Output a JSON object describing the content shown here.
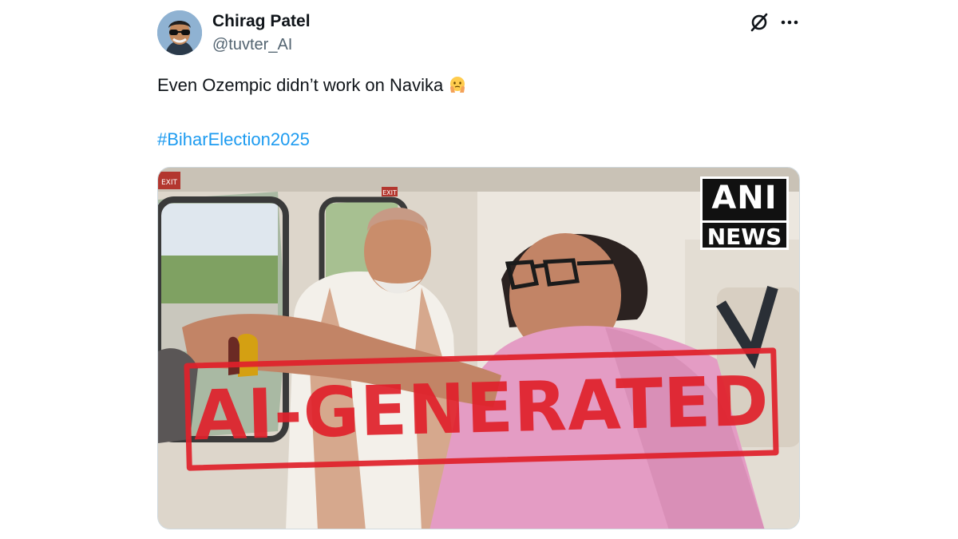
{
  "author": {
    "name": "Chirag Patel",
    "handle": "@tuvter_AI"
  },
  "tweet": {
    "text": "Even Ozempic didn’t work on Navika",
    "emoji": "face-holding-back-tears-emoji",
    "hashtag": "#BiharElection2025"
  },
  "icons": {
    "grok": "grok-icon",
    "more": "more-icon"
  },
  "media": {
    "watermark_line1": "ANI",
    "watermark_line2": "NEWS",
    "stamp_text": "AI-GENERATED",
    "exit_sign_1": "EXIT",
    "exit_sign_2": "EXIT"
  },
  "colors": {
    "link": "#1d9bf0",
    "handle": "#536471",
    "stamp": "#e0212b"
  }
}
